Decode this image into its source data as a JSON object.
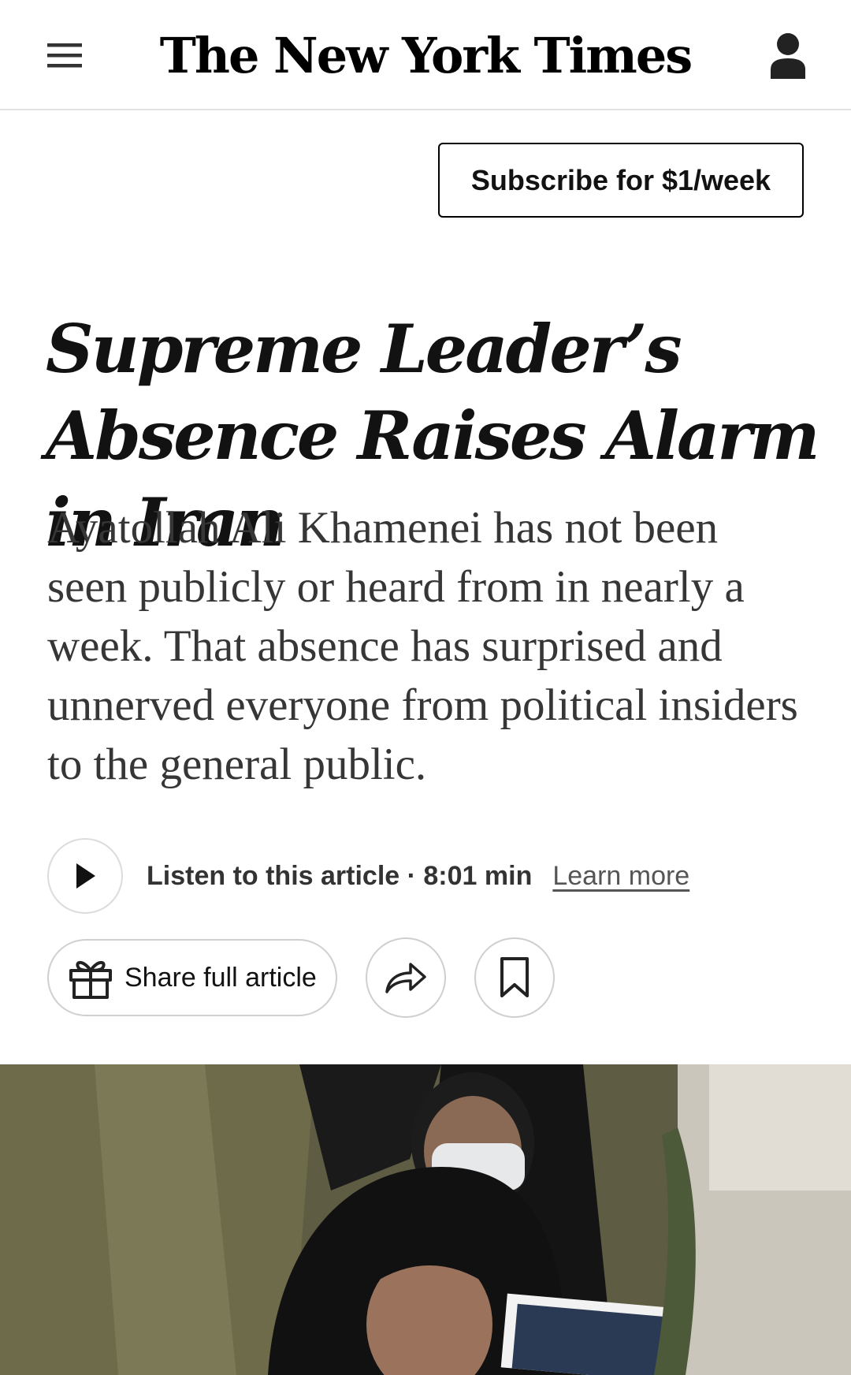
{
  "header": {
    "masthead": "The New York Times",
    "menu_icon": "hamburger-menu-icon",
    "account_icon": "user-account-icon"
  },
  "subscribe": {
    "label": "Subscribe for $1/week"
  },
  "article": {
    "headline": "Supreme Leader’s Absence Raises Alarm in Iran",
    "summary": "Ayatollah Ali Khamenei has not been seen publicly or heard from in nearly a week. That absence has surprised and unnerved everyone from political insiders to the general public."
  },
  "audio": {
    "label": "Listen to this article · 8:01 min",
    "learn_more": "Learn more",
    "play_icon": "play-icon"
  },
  "actions": {
    "share_full_label": "Share full article",
    "gift_icon": "gift-icon",
    "share_icon": "share-arrow-icon",
    "bookmark_icon": "bookmark-icon"
  },
  "colors": {
    "text": "#121212",
    "summary_text": "#363636",
    "border": "#cfcfcf"
  }
}
